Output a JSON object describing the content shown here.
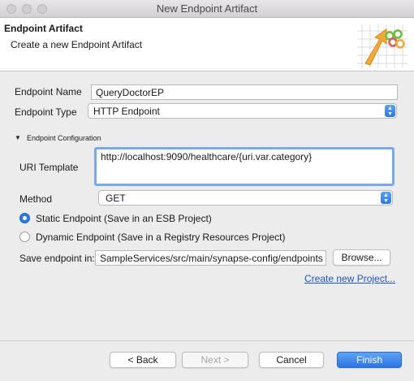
{
  "window": {
    "title": "New Endpoint Artifact"
  },
  "header": {
    "title": "Endpoint Artifact",
    "subtitle": "Create a new Endpoint Artifact"
  },
  "form": {
    "endpoint_name_label": "Endpoint Name",
    "endpoint_name_value": "QueryDoctorEP",
    "endpoint_type_label": "Endpoint Type",
    "endpoint_type_value": "HTTP Endpoint",
    "section_label": "Endpoint Configuration",
    "uri_template_label": "URI Template",
    "uri_template_value": "http://localhost:9090/healthcare/{uri.var.category}",
    "method_label": "Method",
    "method_value": "GET",
    "static_radio_label": "Static Endpoint (Save in an ESB Project)",
    "dynamic_radio_label": "Dynamic Endpoint (Save in a Registry Resources Project)",
    "static_selected": true,
    "save_label": "Save endpoint in:",
    "save_value": "SampleServices/src/main/synapse-config/endpoints",
    "browse_label": "Browse...",
    "create_project_link": "Create new Project..."
  },
  "buttons": {
    "back": "< Back",
    "next": "Next >",
    "cancel": "Cancel",
    "finish": "Finish"
  },
  "colors": {
    "accent": "#2a7ae2",
    "link": "#1a56c8",
    "focus": "#7aa9e8"
  }
}
